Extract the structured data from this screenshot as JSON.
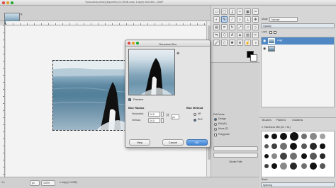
{
  "window": {
    "title": "*[orca-deck-photo] (imported)-3.0 (RGB color, 1 layer) 400x300 – GIMP"
  },
  "status": {
    "coords": "1,1",
    "unit": "px",
    "zoom": "100%",
    "text": "1 copy (2.4 MB)"
  },
  "tool_options": {
    "mode_label": "Mode:",
    "mode_value": "Normal",
    "opacity_label": "Opacity",
    "edit_mode_label": "Edit Mode",
    "edit_modes": [
      "Design",
      "Edit (E)",
      "Move (T)"
    ],
    "polygonal_label": "Polygonal",
    "selection_button": "Selection from Path",
    "stroke_button": "Stroke Path"
  },
  "layers": {
    "mode_label": "Mode",
    "mode_value": "Normal",
    "opacity_label": "Opacity",
    "lock_label": "Lock:",
    "items": [
      {
        "name": "copy",
        "selected": true
      },
      {
        "name": "",
        "selected": false
      }
    ]
  },
  "brushes": {
    "tabs": [
      "Brushes",
      "Patterns",
      "Gradients"
    ],
    "current": "2. Hardness 050 (51 × 51)",
    "basic_label": "Basic",
    "spacing_label": "Spacing"
  },
  "dialog": {
    "title": "Gaussian Blur",
    "preview_label": "Preview",
    "preview_checked": true,
    "blur_radius_label": "Blur Radius",
    "horizontal_label": "Horizontal:",
    "horizontal_value": "24.0",
    "vertical_label": "Vertical:",
    "vertical_value": "24.0",
    "unit_value": "px",
    "blur_method_label": "Blur Method",
    "methods": [
      "IIR",
      "RLE"
    ],
    "selected_method": "RLE",
    "help_button": "Help",
    "cancel_button": "Cancel",
    "ok_button": "OK"
  },
  "colors": {
    "accent": "#4f88c4",
    "ok": "#3f84d6"
  }
}
